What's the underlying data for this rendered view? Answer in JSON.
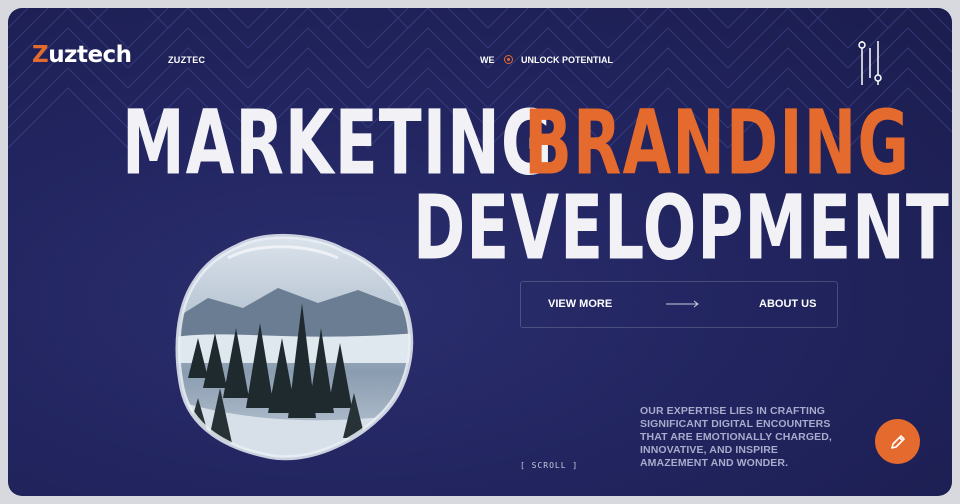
{
  "header": {
    "logo_accent": "Z",
    "logo_rest": "uztech",
    "brand_name": "ZUZTEC",
    "tagline_prefix": "WE",
    "tagline": "UNLOCK POTENTIAL",
    "menu_icon": "sliders-icon"
  },
  "hero": {
    "line1_word1": "MARKETING",
    "line1_word2": "BRANDING",
    "line2": "DEVELOPMENT"
  },
  "cta": {
    "view_more": "VIEW MORE",
    "about_us": "ABOUT US",
    "arrow_icon": "arrow-right-icon"
  },
  "scroll_label": "[ SCROLL ]",
  "description": "OUR EXPERTISE LIES IN CRAFTING SIGNIFICANT DIGITAL ENCOUNTERS THAT ARE EMOTIONALLY CHARGED, INNOVATIVE, AND INSPIRE AMAZEMENT AND WONDER.",
  "fab_icon": "pencil-icon",
  "colors": {
    "accent": "#e56a2e",
    "background": "#222560",
    "text": "#f2f2f6"
  }
}
